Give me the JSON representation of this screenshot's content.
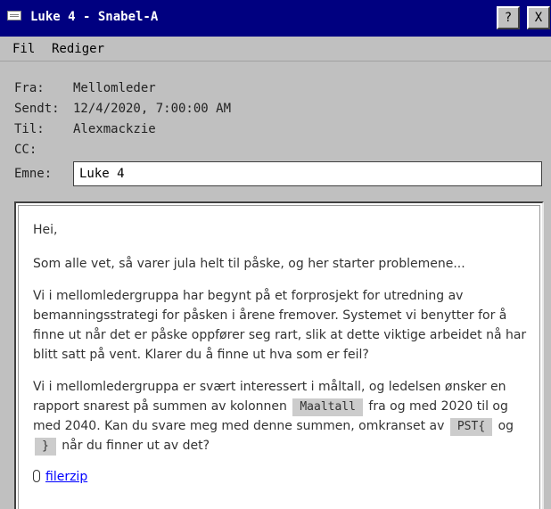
{
  "window": {
    "title": "Luke 4 - Snabel-A",
    "help_label": "?",
    "close_label": "X"
  },
  "menu": {
    "items": [
      "Fil",
      "Rediger"
    ]
  },
  "header": {
    "from_label": "Fra:",
    "from_value": "Mellomleder",
    "sent_label": "Sendt:",
    "sent_value": "12/4/2020, 7:00:00 AM",
    "to_label": "Til:",
    "to_value": "Alexmackzie",
    "cc_label": "CC:",
    "cc_value": "",
    "subject_label": "Emne:",
    "subject_value": "Luke 4"
  },
  "message": {
    "greeting": "Hei,",
    "p1": "Som alle vet, så varer jula helt til påske, og her starter problemene...",
    "p2": "Vi i mellomledergruppa har begynt på et forprosjekt for utredning av bemanningsstrategi for påsken i årene fremover. Systemet vi benytter for å finne ut når det er påske oppfører seg rart, slik at dette viktige arbeidet nå har blitt satt på vent. Klarer du å finne ut hva som er feil?",
    "p3_a": "Vi i mellomledergruppa er svært interessert i måltall, og ledelsen ønsker en rapport snarest på summen av kolonnen",
    "p3_code1": "Maaltall",
    "p3_b": "fra og med 2020 til og med 2040. Kan du svare meg med denne summen, omkranset av",
    "p3_code2": "PST{",
    "p3_c": "og",
    "p3_code3": "}",
    "p3_d": "når du finner ut av det?",
    "attachment": "filerzip"
  }
}
